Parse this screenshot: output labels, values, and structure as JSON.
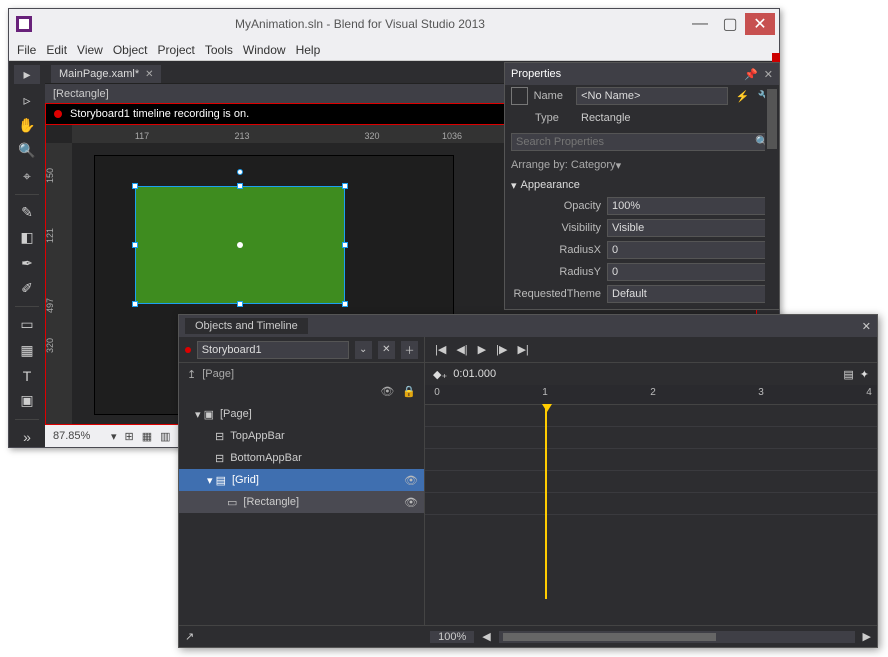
{
  "window": {
    "title": "MyAnimation.sln - Blend for Visual Studio 2013"
  },
  "menu": [
    "File",
    "Edit",
    "View",
    "Object",
    "Project",
    "Tools",
    "Window",
    "Help"
  ],
  "tab": {
    "label": "MainPage.xaml*"
  },
  "breadcrumb": "[Rectangle]",
  "recording_banner": "Storyboard1 timeline recording is on.",
  "ruler_h": [
    "117",
    "213",
    "1036",
    "320"
  ],
  "ruler_v": [
    "150",
    "121",
    "497",
    "320"
  ],
  "status": {
    "zoom": "87.85%"
  },
  "properties": {
    "title": "Properties",
    "name_label": "Name",
    "name_value": "<No Name>",
    "type_label": "Type",
    "type_value": "Rectangle",
    "search_placeholder": "Search Properties",
    "arrange_label": "Arrange by: Category",
    "section": "Appearance",
    "rows": {
      "opacity_label": "Opacity",
      "opacity_value": "100%",
      "visibility_label": "Visibility",
      "visibility_value": "Visible",
      "radiusx_label": "RadiusX",
      "radiusx_value": "0",
      "radiusy_label": "RadiusY",
      "radiusy_value": "0",
      "theme_label": "RequestedTheme",
      "theme_value": "Default"
    }
  },
  "timeline": {
    "title": "Objects and Timeline",
    "storyboard": "Storyboard1",
    "crumb": "[Page]",
    "time": "0:01.000",
    "ticks": [
      "0",
      "1",
      "2",
      "3",
      "4"
    ],
    "zoom": "100%",
    "tree": {
      "page": "[Page]",
      "top": "TopAppBar",
      "bottom": "BottomAppBar",
      "grid": "[Grid]",
      "rect": "[Rectangle]"
    }
  }
}
